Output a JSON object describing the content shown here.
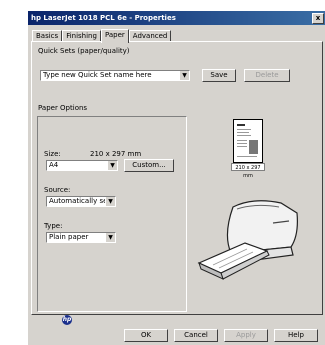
{
  "window": {
    "title": "hp LaserJet 1018 PCL 6e - Properties",
    "close_glyph": "x"
  },
  "tabs": [
    {
      "label": "Basics"
    },
    {
      "label": "Finishing"
    },
    {
      "label": "Paper"
    },
    {
      "label": "Advanced"
    }
  ],
  "quick_sets": {
    "label": "Quick Sets (paper/quality)",
    "value": "Type new Quick Set name here",
    "save_label": "Save",
    "delete_label": "Delete"
  },
  "paper_options": {
    "group_label": "Paper Options",
    "size_label": "Size:",
    "size_dimensions": "210 x 297 mm",
    "size_value": "A4",
    "custom_label": "Custom...",
    "source_label": "Source:",
    "source_value": "Automatically select",
    "type_label": "Type:",
    "type_value": "Plain paper"
  },
  "preview": {
    "label": "210 x 297 mm"
  },
  "footer": {
    "ok_label": "OK",
    "cancel_label": "Cancel",
    "apply_label": "Apply",
    "help_label": "Help"
  },
  "logo": {
    "text": "hp"
  },
  "colors": {
    "titlebar": "#0a246a",
    "face": "#d6d3ce"
  }
}
